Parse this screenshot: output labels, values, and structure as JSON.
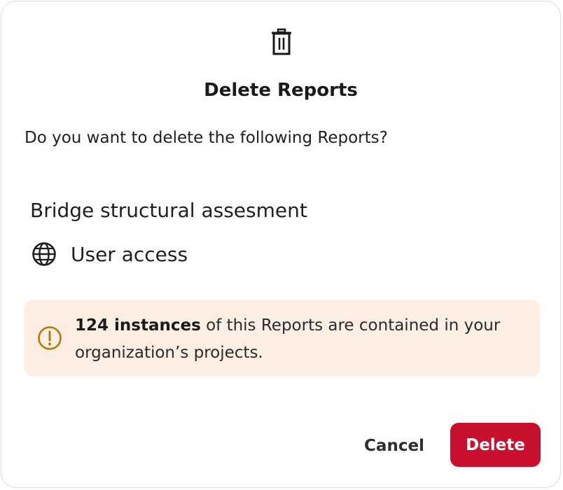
{
  "dialog": {
    "icon": "trash-icon",
    "title": "Delete Reports",
    "question": "Do you want to delete the following Reports?",
    "report_name": "Bridge structural assesment",
    "access": {
      "icon": "globe-icon",
      "label": "User access"
    },
    "warning": {
      "icon": "warning-circle-icon",
      "count_text": "124 instances",
      "rest_text": " of this Reports are contained in your organization’s projects."
    },
    "buttons": {
      "cancel_label": "Cancel",
      "delete_label": "Delete"
    }
  },
  "colors": {
    "danger": "#c8102e",
    "warning_bg": "#fdeee4",
    "warning_icon": "#b8770b",
    "text": "#1f1f1f",
    "border": "#dcdcdc"
  }
}
